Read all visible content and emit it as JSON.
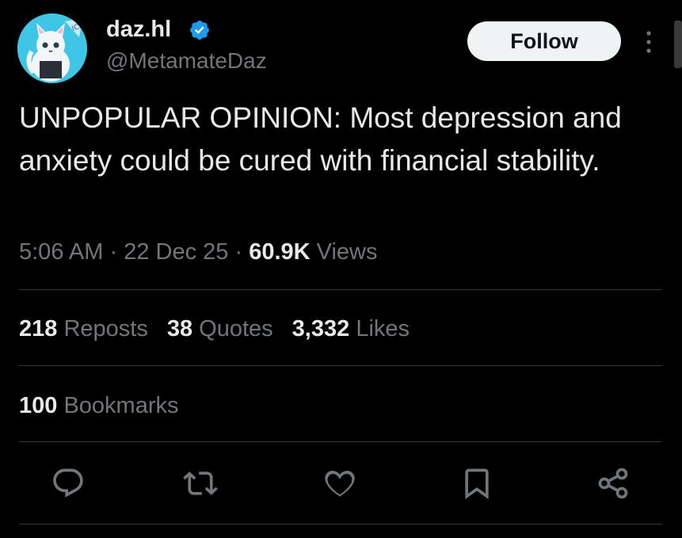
{
  "author": {
    "display_name": "daz.hl",
    "handle": "@MetamateDaz",
    "verified_color": "#1d9bf0"
  },
  "header": {
    "follow_label": "Follow",
    "more_icon": "more-vertical-icon"
  },
  "tweet": {
    "text": "UNPOPULAR OPINION: Most depression and anxiety could be cured with financial stability.",
    "time": "5:06 AM",
    "separator": "·",
    "date": "22 Dec 25",
    "views_count": "60.9K",
    "views_label": "Views"
  },
  "stats": {
    "reposts_count": "218",
    "reposts_label": "Reposts",
    "quotes_count": "38",
    "quotes_label": "Quotes",
    "likes_count": "3,332",
    "likes_label": "Likes",
    "bookmarks_count": "100",
    "bookmarks_label": "Bookmarks"
  },
  "actions": [
    "reply-icon",
    "repost-icon",
    "like-icon",
    "bookmark-icon",
    "share-icon"
  ],
  "colors": {
    "background": "#000000",
    "text_primary": "#e7e9ea",
    "text_secondary": "#71767b",
    "divider": "#2f3336",
    "accent": "#1d9bf0"
  }
}
